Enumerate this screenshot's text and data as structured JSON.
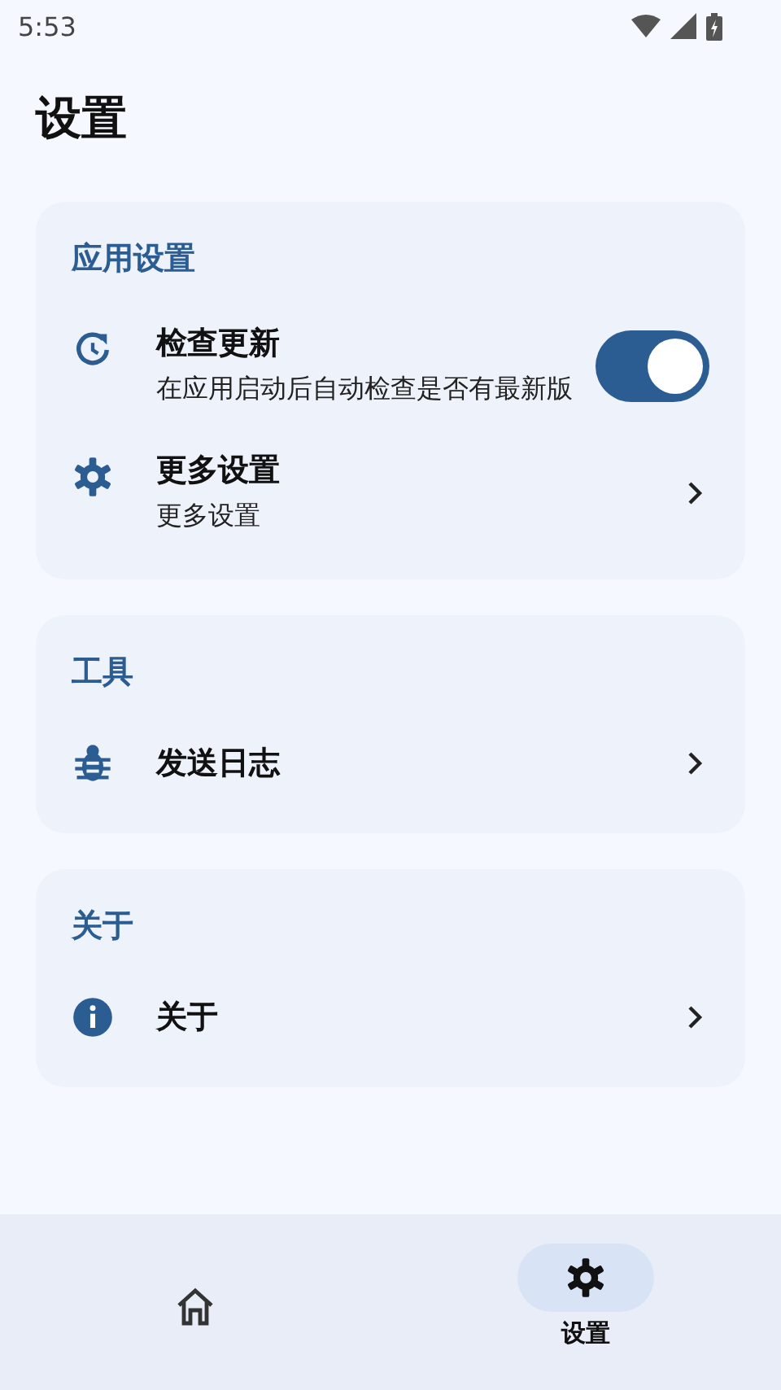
{
  "status_bar": {
    "time": "5:53"
  },
  "title": "设置",
  "sections": [
    {
      "title": "应用设置",
      "items": [
        {
          "kind": "switch",
          "title": "检查更新",
          "subtitle": "在应用启动后自动检查是否有最新版",
          "on": true
        },
        {
          "kind": "link",
          "title": "更多设置",
          "subtitle": "更多设置"
        }
      ]
    },
    {
      "title": "工具",
      "items": [
        {
          "kind": "link",
          "title": "发送日志"
        }
      ]
    },
    {
      "title": "关于",
      "items": [
        {
          "kind": "link",
          "title": "关于"
        }
      ]
    }
  ],
  "nav": [
    {
      "selected": false
    },
    {
      "label": "设置",
      "selected": true
    }
  ]
}
